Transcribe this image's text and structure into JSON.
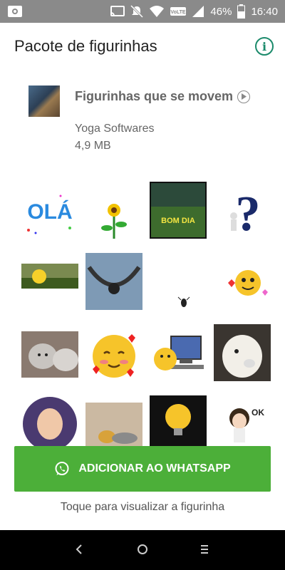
{
  "status": {
    "time": "16:40",
    "battery": "46%",
    "volte": "VoLTE",
    "icons": [
      "screenshot-icon",
      "cast-icon",
      "mute-icon",
      "wifi-icon",
      "signal-icon",
      "battery-icon"
    ]
  },
  "header": {
    "title": "Pacote de figurinhas",
    "info_icon": "info-icon"
  },
  "pack": {
    "name": "Figurinhas que se movem",
    "author": "Yoga Softwares",
    "size": "4,9 MB"
  },
  "stickers": [
    {
      "name": "ola-text",
      "text": "OLÁ"
    },
    {
      "name": "sunflower",
      "text": ""
    },
    {
      "name": "bom-dia",
      "text": "BOM DIA"
    },
    {
      "name": "question-mark",
      "text": "?"
    },
    {
      "name": "sunrise",
      "text": ""
    },
    {
      "name": "hammock",
      "text": ""
    },
    {
      "name": "bug",
      "text": ""
    },
    {
      "name": "emoji-hearts",
      "text": ""
    },
    {
      "name": "cat",
      "text": ""
    },
    {
      "name": "blushing-emoji",
      "text": ""
    },
    {
      "name": "computer-emoji",
      "text": ""
    },
    {
      "name": "llama",
      "text": ""
    },
    {
      "name": "girl-portrait",
      "text": ""
    },
    {
      "name": "ducklings",
      "text": ""
    },
    {
      "name": "bulb-emoji",
      "text": ""
    },
    {
      "name": "ok-girl",
      "text": "OK"
    }
  ],
  "actions": {
    "add_button": "ADICIONAR AO WHATSAPP",
    "hint": "Toque para visualizar a figurinha"
  },
  "colors": {
    "accent": "#4caf39",
    "info": "#1b8a6b",
    "statusbar": "#8a8a8a"
  }
}
